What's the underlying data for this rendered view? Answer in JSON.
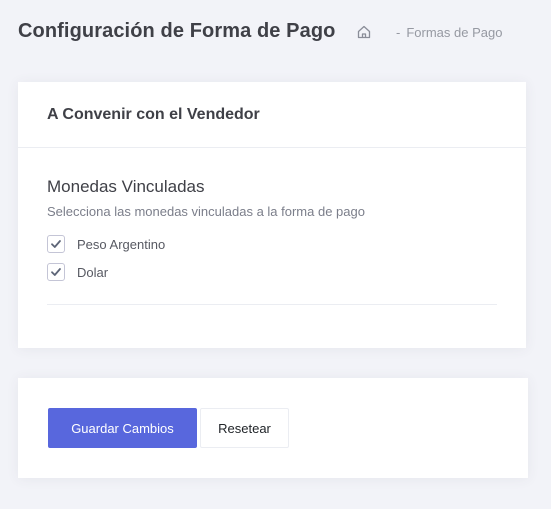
{
  "header": {
    "title": "Configuración de Forma de Pago",
    "breadcrumb": {
      "home_icon": "home-icon",
      "separator": "-",
      "current": "Formas de Pago"
    }
  },
  "card": {
    "title": "A Convenir con el Vendedor",
    "section_title": "Monedas Vinculadas",
    "section_description": "Selecciona las monedas vinculadas a la forma de pago",
    "currencies": [
      {
        "label": "Peso Argentino",
        "checked": true
      },
      {
        "label": "Dolar",
        "checked": true
      }
    ]
  },
  "actions": {
    "save_label": "Guardar Cambios",
    "reset_label": "Resetear"
  },
  "colors": {
    "background": "#f2f3f8",
    "primary": "#5867dd",
    "card": "#ffffff",
    "check_mark": "#5d6577"
  }
}
